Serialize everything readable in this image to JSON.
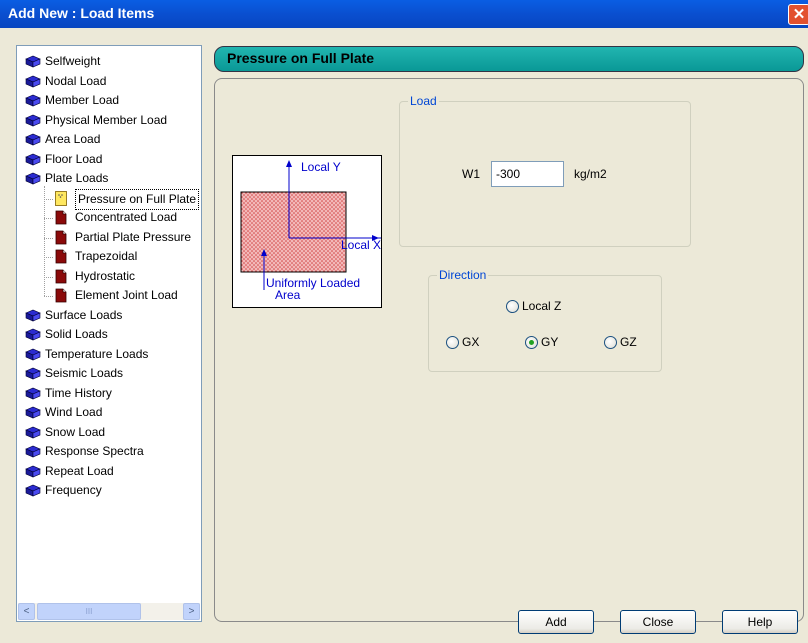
{
  "window": {
    "title": "Add New : Load Items",
    "close_glyph": "✕"
  },
  "tree": {
    "items": [
      {
        "label": "Selfweight",
        "icon": "book-icon",
        "level": 0
      },
      {
        "label": "Nodal Load",
        "icon": "book-icon",
        "level": 0
      },
      {
        "label": "Member Load",
        "icon": "book-icon",
        "level": 0
      },
      {
        "label": "Physical Member Load",
        "icon": "book-icon",
        "level": 0
      },
      {
        "label": "Area Load",
        "icon": "book-icon",
        "level": 0
      },
      {
        "label": "Floor Load",
        "icon": "book-icon",
        "level": 0
      },
      {
        "label": "Plate Loads",
        "icon": "book-icon",
        "level": 0
      },
      {
        "label": "Pressure on Full Plate",
        "icon": "selected-page-icon",
        "level": 1,
        "selected": true
      },
      {
        "label": "Concentrated Load",
        "icon": "page-icon",
        "level": 1
      },
      {
        "label": "Partial Plate Pressure",
        "icon": "page-icon",
        "level": 1
      },
      {
        "label": "Trapezoidal",
        "icon": "page-icon",
        "level": 1
      },
      {
        "label": "Hydrostatic",
        "icon": "page-icon",
        "level": 1
      },
      {
        "label": "Element Joint Load",
        "icon": "page-icon",
        "level": 1
      },
      {
        "label": "Surface Loads",
        "icon": "book-icon",
        "level": 0
      },
      {
        "label": "Solid Loads",
        "icon": "book-icon",
        "level": 0
      },
      {
        "label": "Temperature Loads",
        "icon": "book-icon",
        "level": 0
      },
      {
        "label": "Seismic Loads",
        "icon": "book-icon",
        "level": 0
      },
      {
        "label": "Time History",
        "icon": "book-icon",
        "level": 0
      },
      {
        "label": "Wind Load",
        "icon": "book-icon",
        "level": 0
      },
      {
        "label": "Snow Load",
        "icon": "book-icon",
        "level": 0
      },
      {
        "label": "Response Spectra",
        "icon": "book-icon",
        "level": 0
      },
      {
        "label": "Repeat Load",
        "icon": "book-icon",
        "level": 0
      },
      {
        "label": "Frequency",
        "icon": "book-icon",
        "level": 0
      }
    ],
    "scroll_left": "<",
    "scroll_right": ">",
    "thumb_grip": "III"
  },
  "panel": {
    "header": "Pressure on Full Plate"
  },
  "diagram": {
    "local_y": "Local Y",
    "local_x": "Local X",
    "area_line1": "Uniformly Loaded",
    "area_line2": "Area"
  },
  "load": {
    "group_label": "Load",
    "w1_label": "W1",
    "w1_value": "-300",
    "unit": "kg/m2"
  },
  "direction": {
    "group_label": "Direction",
    "options": [
      {
        "label": "Local Z",
        "selected": false
      },
      {
        "label": "GX",
        "selected": false
      },
      {
        "label": "GY",
        "selected": true
      },
      {
        "label": "GZ",
        "selected": false
      }
    ]
  },
  "buttons": {
    "add": "Add",
    "close": "Close",
    "help": "Help"
  },
  "colors": {
    "title_bar": "#0a5ee3",
    "header": "#1aa8a4",
    "group_label": "#0046d5",
    "diagram_fill": "#e8a0a0",
    "diagram_axes": "#0000cc"
  }
}
